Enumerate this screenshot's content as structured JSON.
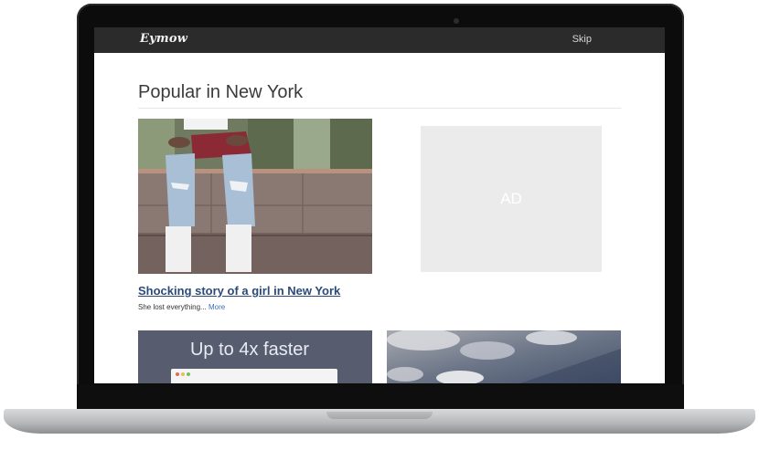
{
  "app": {
    "logo": "Eymow",
    "skip_label": "Skip"
  },
  "main": {
    "title": "Popular in New York",
    "article": {
      "headline": "Shocking story of a girl in New York",
      "description": "She lost everything...",
      "more_label": "More"
    },
    "ad_label": "AD",
    "promo": {
      "text": "Up to 4x faster"
    }
  },
  "colors": {
    "topbar": "#2b2b2b",
    "link": "#2b4a7a",
    "promo_bg": "#585c6f",
    "ad_bg": "#ebebeb"
  },
  "icons": [
    "camera-icon"
  ]
}
